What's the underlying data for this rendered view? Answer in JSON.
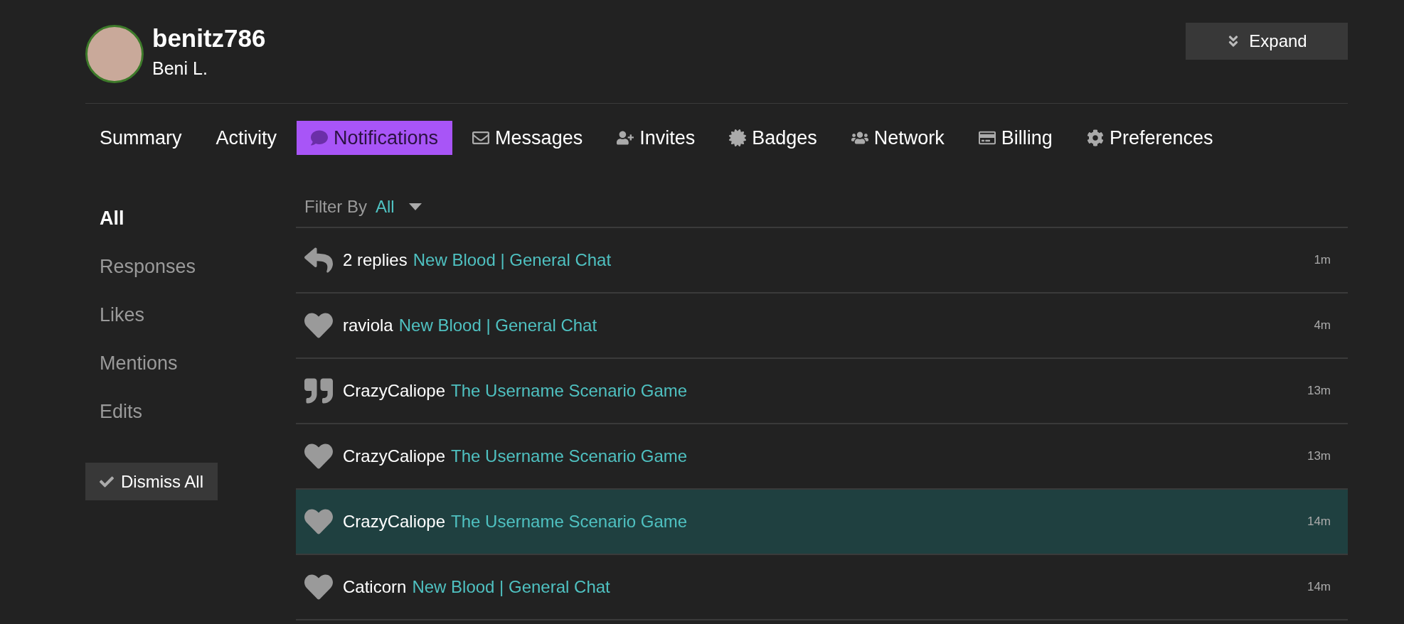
{
  "profile": {
    "username": "benitz786",
    "display_name": "Beni L."
  },
  "expand_button": {
    "label": "Expand"
  },
  "tabs": [
    {
      "label": "Summary",
      "selected": false
    },
    {
      "label": "Activity",
      "selected": false
    },
    {
      "label": "Notifications",
      "selected": true
    },
    {
      "label": "Messages",
      "selected": false
    },
    {
      "label": "Invites",
      "selected": false
    },
    {
      "label": "Badges",
      "selected": false
    },
    {
      "label": "Network",
      "selected": false
    },
    {
      "label": "Billing",
      "selected": false
    },
    {
      "label": "Preferences",
      "selected": false
    }
  ],
  "sidebar": {
    "items": [
      {
        "label": "All",
        "selected": true
      },
      {
        "label": "Responses",
        "selected": false
      },
      {
        "label": "Likes",
        "selected": false
      },
      {
        "label": "Mentions",
        "selected": false
      },
      {
        "label": "Edits",
        "selected": false
      }
    ],
    "dismiss_button": {
      "label": "Dismiss All"
    }
  },
  "filter": {
    "label": "Filter By",
    "value": "All"
  },
  "notifications": [
    {
      "kind": "reply",
      "actor": "2 replies",
      "topic": "New Blood | General Chat",
      "time": "1m",
      "selected": false
    },
    {
      "kind": "like",
      "actor": "raviola",
      "topic": "New Blood | General Chat",
      "time": "4m",
      "selected": false
    },
    {
      "kind": "quote",
      "actor": "CrazyCaliope",
      "topic": "The Username Scenario Game",
      "time": "13m",
      "selected": false
    },
    {
      "kind": "like",
      "actor": "CrazyCaliope",
      "topic": "The Username Scenario Game",
      "time": "13m",
      "selected": false
    },
    {
      "kind": "like",
      "actor": "CrazyCaliope",
      "topic": "The Username Scenario Game",
      "time": "14m",
      "selected": true
    },
    {
      "kind": "like",
      "actor": "Caticorn",
      "topic": "New Blood | General Chat",
      "time": "14m",
      "selected": false
    }
  ]
}
